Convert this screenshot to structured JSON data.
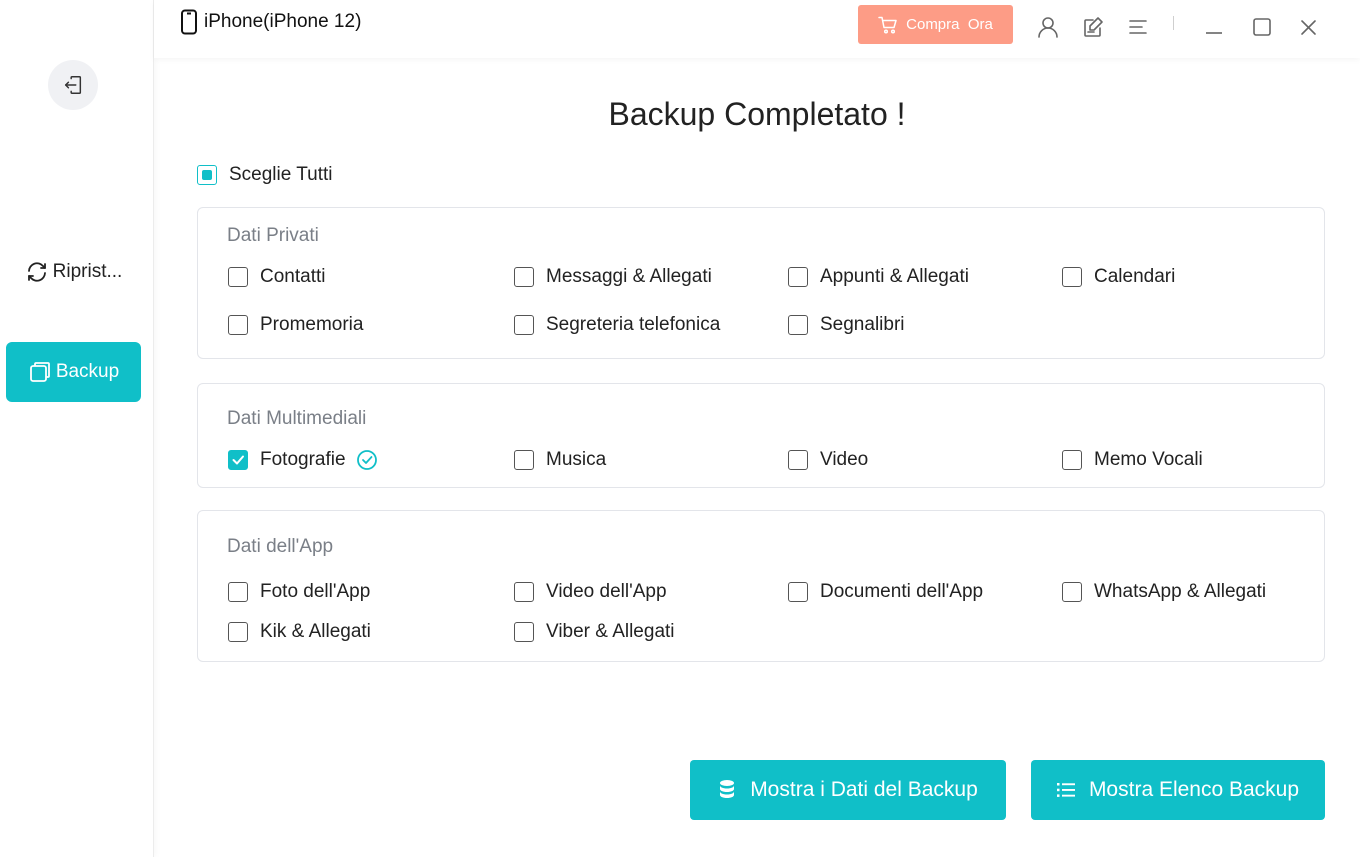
{
  "window": {
    "device_name": "iPhone(iPhone 12)",
    "buy_label": "Compra  Ora",
    "colors": {
      "accent": "#10bfc8",
      "buy": "#fd9c86"
    }
  },
  "sidebar": {
    "items": [
      {
        "label": "Riprist...",
        "icon": "restore-icon",
        "active": false
      },
      {
        "label": "Backup",
        "icon": "backup-icon",
        "active": true
      }
    ]
  },
  "main": {
    "title": "Backup Completato !",
    "select_all_label": "Sceglie Tutti",
    "sections": [
      {
        "title": "Dati Privati",
        "items": [
          {
            "label": "Contatti",
            "checked": false
          },
          {
            "label": "Messaggi & Allegati",
            "checked": false
          },
          {
            "label": "Appunti & Allegati",
            "checked": false
          },
          {
            "label": "Calendari",
            "checked": false
          },
          {
            "label": "Promemoria",
            "checked": false
          },
          {
            "label": "Segreteria telefonica",
            "checked": false
          },
          {
            "label": "Segnalibri",
            "checked": false
          }
        ]
      },
      {
        "title": "Dati Multimediali",
        "items": [
          {
            "label": "Fotografie",
            "checked": true
          },
          {
            "label": "Musica",
            "checked": false
          },
          {
            "label": "Video",
            "checked": false
          },
          {
            "label": "Memo Vocali",
            "checked": false
          }
        ]
      },
      {
        "title": "Dati dell'App",
        "items": [
          {
            "label": "Foto dell'App",
            "checked": false
          },
          {
            "label": "Video dell'App",
            "checked": false
          },
          {
            "label": "Documenti dell'App",
            "checked": false
          },
          {
            "label": "WhatsApp & Allegati",
            "checked": false
          },
          {
            "label": "Kik & Allegati",
            "checked": false
          },
          {
            "label": "Viber & Allegati",
            "checked": false
          }
        ]
      }
    ],
    "buttons": {
      "view_backup_data": "Mostra i Dati del Backup",
      "view_backup_list": "Mostra Elenco Backup"
    }
  }
}
